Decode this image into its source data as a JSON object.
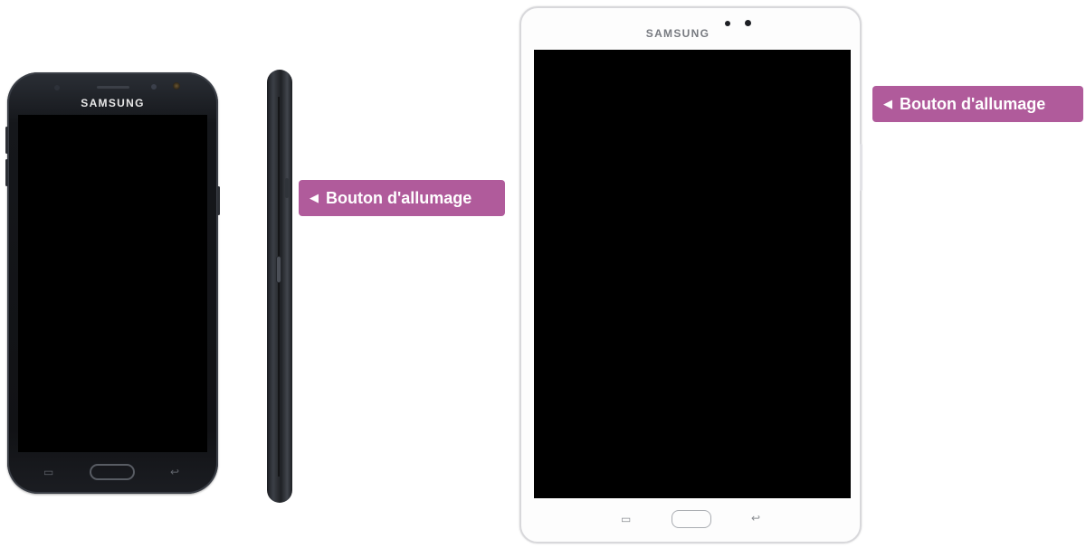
{
  "phone": {
    "brand": "SAMSUNG",
    "recent_key_icon": "recent-apps-icon",
    "back_key_icon": "back-icon"
  },
  "tablet": {
    "brand": "SAMSUNG",
    "recent_key_icon": "recent-apps-icon",
    "back_key_icon": "back-icon"
  },
  "callouts": [
    {
      "arrow_icon": "left-triangle-icon",
      "label": "Bouton d'allumage"
    },
    {
      "arrow_icon": "left-triangle-icon",
      "label": "Bouton d'allumage"
    }
  ],
  "colors": {
    "callout_bg": "#b05b9b",
    "callout_text": "#ffffff",
    "phone_body": "#15171b",
    "tablet_body": "#fdfdfd",
    "screen": "#000000"
  }
}
